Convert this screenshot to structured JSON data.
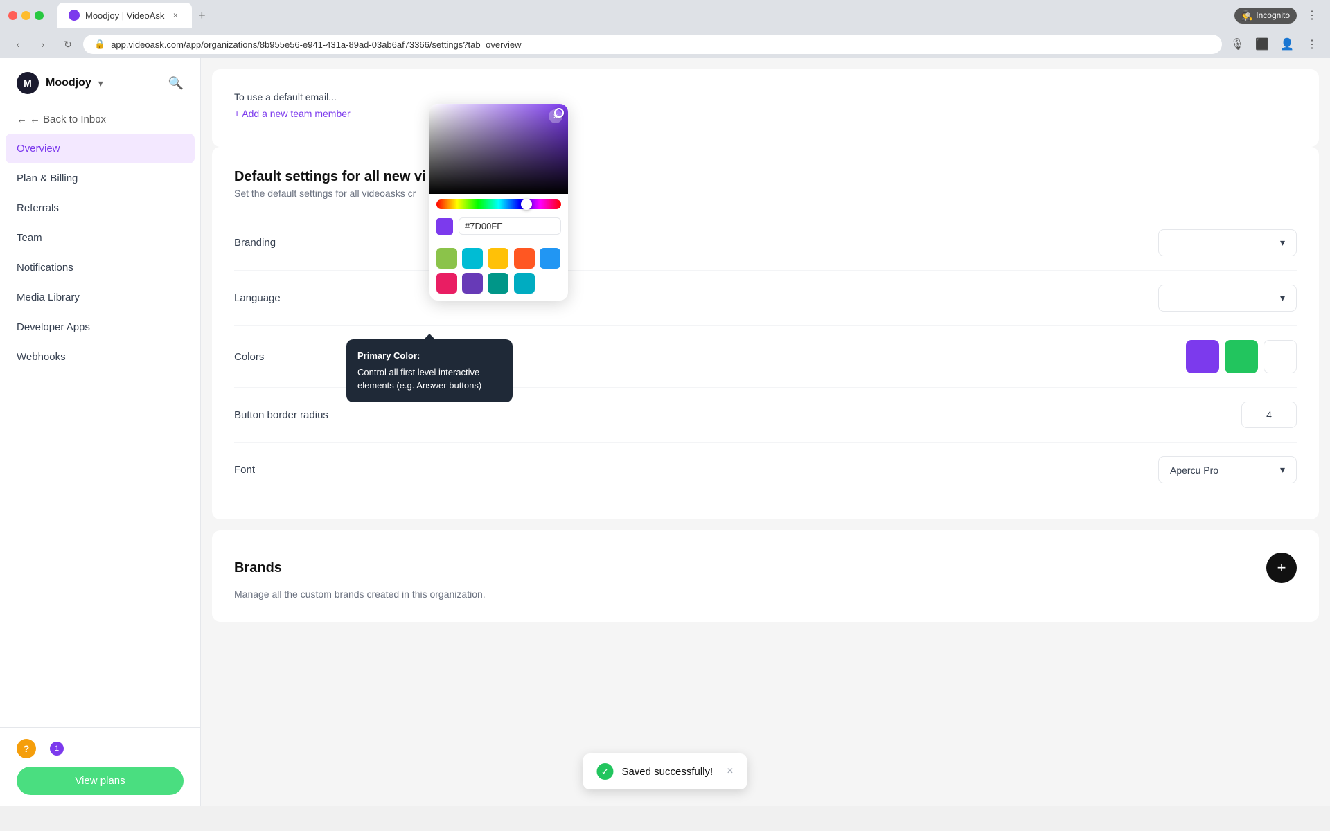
{
  "browser": {
    "url": "app.videoask.com/app/organizations/8b955e56-e941-431a-89ad-03ab6af73366/settings?tab=overview",
    "tab_title": "Moodjoy | VideoAsk",
    "tab_favicon": "M",
    "incognito_label": "Incognito"
  },
  "sidebar": {
    "org_name": "Moodjoy",
    "back_label": "← Back to Inbox",
    "nav_items": [
      {
        "id": "overview",
        "label": "Overview",
        "active": true
      },
      {
        "id": "plan-billing",
        "label": "Plan & Billing",
        "active": false
      },
      {
        "id": "referrals",
        "label": "Referrals",
        "active": false
      },
      {
        "id": "team",
        "label": "Team",
        "active": false
      },
      {
        "id": "notifications",
        "label": "Notifications",
        "active": false
      },
      {
        "id": "media-library",
        "label": "Media Library",
        "active": false
      },
      {
        "id": "developer-apps",
        "label": "Developer Apps",
        "active": false
      },
      {
        "id": "webhooks",
        "label": "Webhooks",
        "active": false
      }
    ],
    "help_label": "?",
    "notification_count": "1",
    "view_plans_label": "View plans"
  },
  "top_section": {
    "add_member_label": "+ Add a new team member",
    "default_email_text": "To use a default email..."
  },
  "settings_section": {
    "title": "Default settings for all new vi",
    "description": "Set the default settings for all videoasks cr",
    "branding_label": "Branding",
    "language_label": "Language",
    "language_value": "",
    "colors_label": "Colors",
    "button_border_label": "Button border radius",
    "button_border_value": "4",
    "font_label": "Font",
    "font_value": "Apercu Pro"
  },
  "color_picker": {
    "hex_value": "#7D00FE",
    "close_icon": "×",
    "presets": [
      {
        "color": "#8bc34a",
        "label": "lime-green"
      },
      {
        "color": "#00bcd4",
        "label": "cyan"
      },
      {
        "color": "#ffc107",
        "label": "amber"
      },
      {
        "color": "#ff5722",
        "label": "deep-orange"
      },
      {
        "color": "#2196f3",
        "label": "blue"
      },
      {
        "color": "#e91e63",
        "label": "pink"
      },
      {
        "color": "#673ab7",
        "label": "deep-purple"
      },
      {
        "color": "#009688",
        "label": "teal"
      },
      {
        "color": "#00bcd4",
        "label": "light-blue"
      }
    ]
  },
  "tooltip": {
    "title": "Primary Color:",
    "description": "Control all first level interactive elements (e.g. Answer buttons)"
  },
  "brands_section": {
    "title": "Brands",
    "description": "Manage all the custom brands created in this organization.",
    "add_icon": "+"
  },
  "toast": {
    "message": "Saved successfully!",
    "close_icon": "×",
    "success_icon": "✓"
  }
}
